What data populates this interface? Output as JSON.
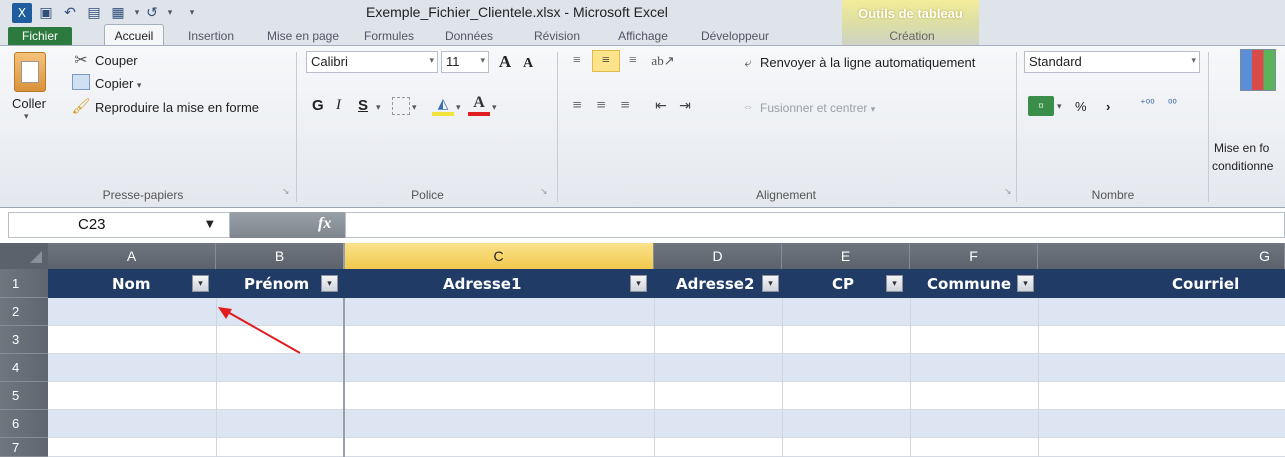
{
  "window": {
    "title": "Exemple_Fichier_Clientele.xlsx  -  Microsoft Excel",
    "context_tab": "Outils de tableau"
  },
  "tabs": [
    "Fichier",
    "Accueil",
    "Insertion",
    "Mise en page",
    "Formules",
    "Données",
    "Révision",
    "Affichage",
    "Développeur",
    "Création"
  ],
  "clipboard": {
    "paste": "Coller",
    "cut": "Couper",
    "copy": "Copier",
    "copy_drop": "▾",
    "format_painter": "Reproduire la mise en forme",
    "label": "Presse-papiers"
  },
  "font": {
    "name": "Calibri",
    "size": "11",
    "bold": "G",
    "italic": "I",
    "underline": "S",
    "label": "Police"
  },
  "alignment": {
    "wrap": "Renvoyer à la ligne automatiquement",
    "merge": "Fusionner et centrer",
    "merge_drop": "▾",
    "label": "Alignement"
  },
  "number": {
    "format": "Standard",
    "percent": "%",
    "comma": "›",
    "inc": "⁺⁰⁰",
    "dec": "⁰⁰",
    "label": "Nombre"
  },
  "styles": {
    "cond_line1": "Mise en fo",
    "cond_line2": "conditionne"
  },
  "formula_bar": {
    "namebox": "C23",
    "fx": "fx",
    "value": ""
  },
  "columns": [
    "A",
    "B",
    "C",
    "D",
    "E",
    "F",
    "G"
  ],
  "rows": [
    "1",
    "2",
    "3",
    "4",
    "5",
    "6",
    "7"
  ],
  "table_headers": [
    "Nom",
    "Prénom",
    "Adresse1",
    "Adresse2",
    "CP",
    "Commune",
    "Courriel"
  ],
  "colors": {
    "header_band": "#1f3b66",
    "row_band": "#dce5f1",
    "annotation_arrow": "#e11d1d",
    "selected_col": "#f1c84e"
  }
}
